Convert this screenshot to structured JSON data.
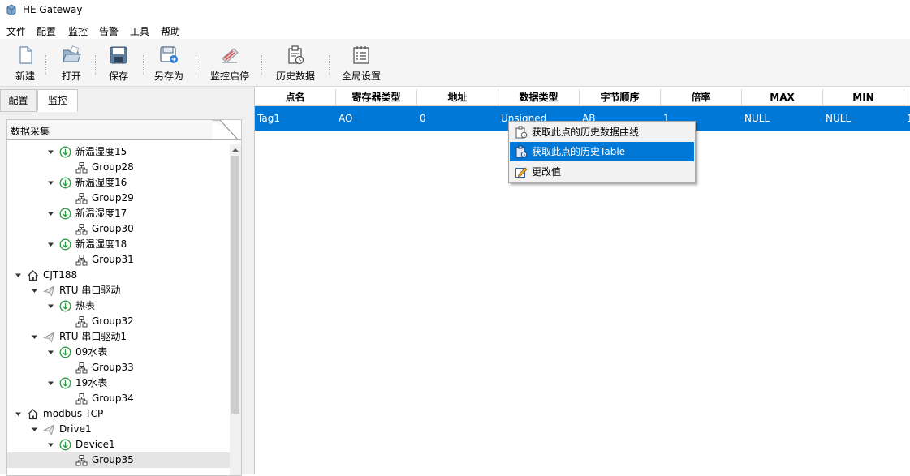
{
  "window": {
    "title": "HE Gateway",
    "app_icon": "gateway-app-icon"
  },
  "menu": {
    "items": [
      "文件",
      "配置",
      "监控",
      "告警",
      "工具",
      "帮助"
    ]
  },
  "toolbar": {
    "buttons": [
      {
        "label": "新建",
        "icon": "new-file-icon"
      },
      {
        "label": "打开",
        "icon": "open-folder-icon"
      },
      {
        "label": "保存",
        "icon": "save-icon"
      },
      {
        "label": "另存为",
        "icon": "save-as-icon"
      },
      {
        "label": "监控启停",
        "icon": "monitor-toggle-icon"
      },
      {
        "label": "历史数据",
        "icon": "history-data-icon"
      },
      {
        "label": "全局设置",
        "icon": "global-settings-icon"
      }
    ]
  },
  "left_panel": {
    "tabs": [
      {
        "label": "配置",
        "active": false
      },
      {
        "label": "监控",
        "active": true
      }
    ],
    "section_title": "数据采集",
    "tree": [
      {
        "label": "新温湿度15",
        "type": "device",
        "level": 2,
        "expanded": true
      },
      {
        "label": "Group28",
        "type": "group",
        "level": 3
      },
      {
        "label": "新温湿度16",
        "type": "device",
        "level": 2,
        "expanded": true
      },
      {
        "label": "Group29",
        "type": "group",
        "level": 3
      },
      {
        "label": "新温湿度17",
        "type": "device",
        "level": 2,
        "expanded": true
      },
      {
        "label": "Group30",
        "type": "group",
        "level": 3
      },
      {
        "label": "新温湿度18",
        "type": "device",
        "level": 2,
        "expanded": true
      },
      {
        "label": "Group31",
        "type": "group",
        "level": 3
      },
      {
        "label": "CJT188",
        "type": "protocol",
        "level": 0,
        "expanded": true
      },
      {
        "label": "RTU 串口驱动",
        "type": "driver",
        "level": 1,
        "expanded": true
      },
      {
        "label": "热表",
        "type": "device",
        "level": 2,
        "expanded": true
      },
      {
        "label": "Group32",
        "type": "group",
        "level": 3
      },
      {
        "label": "RTU 串口驱动1",
        "type": "driver",
        "level": 1,
        "expanded": true
      },
      {
        "label": "09水表",
        "type": "device",
        "level": 2,
        "expanded": true
      },
      {
        "label": "Group33",
        "type": "group",
        "level": 3
      },
      {
        "label": "19水表",
        "type": "device",
        "level": 2,
        "expanded": true
      },
      {
        "label": "Group34",
        "type": "group",
        "level": 3
      },
      {
        "label": "modbus TCP",
        "type": "protocol",
        "level": 0,
        "expanded": true
      },
      {
        "label": "Drive1",
        "type": "driver",
        "level": 1,
        "expanded": true
      },
      {
        "label": "Device1",
        "type": "device",
        "level": 2,
        "expanded": true
      },
      {
        "label": "Group35",
        "type": "group",
        "level": 3,
        "selected": true
      }
    ]
  },
  "table": {
    "columns": [
      "点名",
      "寄存器类型",
      "地址",
      "数据类型",
      "字节顺序",
      "倍率",
      "MAX",
      "MIN"
    ],
    "rows": [
      [
        "Tag1",
        "AO",
        "0",
        "Unsigned",
        "AB",
        "1",
        "NULL",
        "NULL",
        "1"
      ]
    ]
  },
  "context_menu": {
    "items": [
      {
        "label": "获取此点的历史数据曲线",
        "icon": "history-chart-icon",
        "highlighted": false
      },
      {
        "label": "获取此点的历史Table",
        "icon": "history-table-icon",
        "highlighted": true
      },
      {
        "label": "更改值",
        "icon": "edit-value-icon",
        "highlighted": false
      }
    ]
  },
  "colors": {
    "selection": "#0078d7",
    "toolbar_bg": "#f5f5f5",
    "panel_bg": "#f0f0f0"
  }
}
